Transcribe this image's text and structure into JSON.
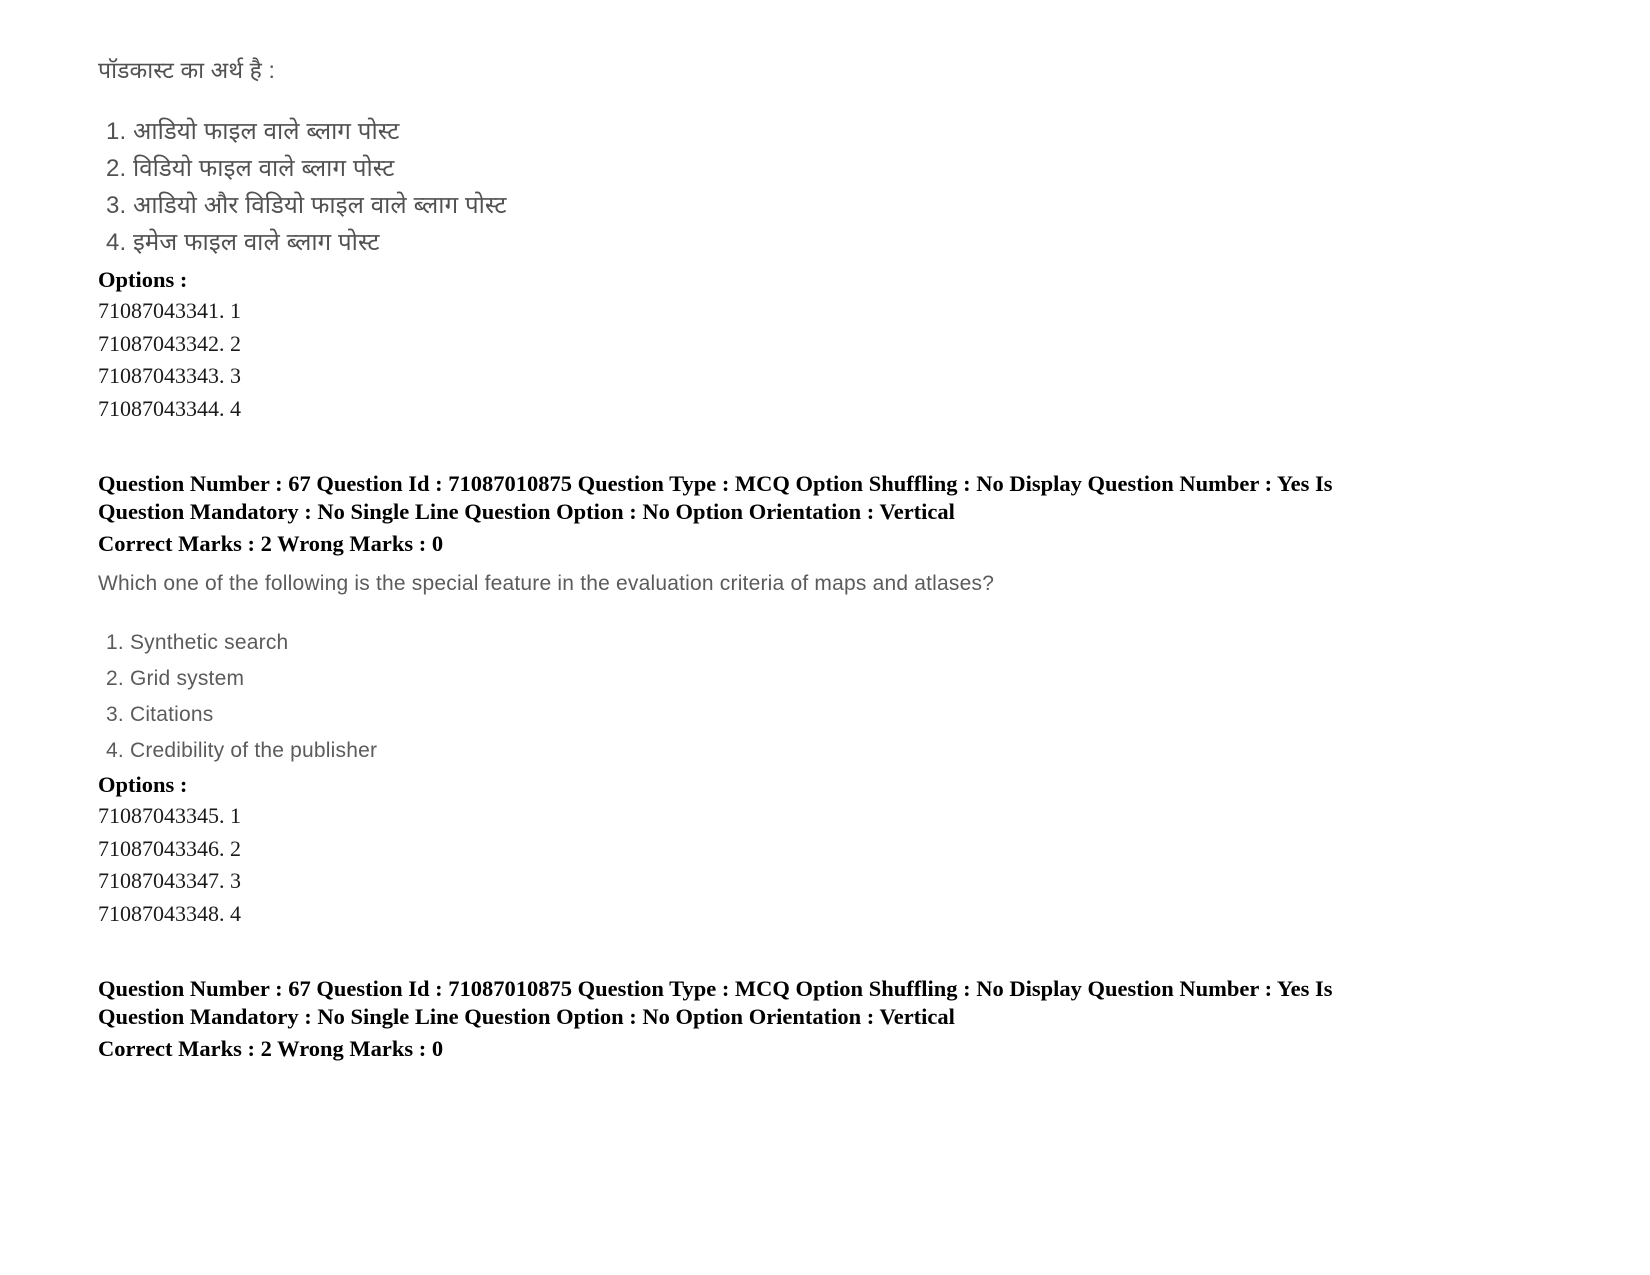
{
  "page": {
    "background": "#ffffff",
    "text_color": "#000000",
    "scan_text_color": "#3a3a3a"
  },
  "question_66": {
    "stem": "पॉडकास्ट का अर्थ है :",
    "choices": [
      "1. आडियो फाइल वाले ब्लाग पोस्ट",
      "2. विडियो  फाइल वाले ब्लाग पोस्ट",
      "3. आडियो और विडियो फाइल वाले ब्लाग पोस्ट",
      "4. इमेज फाइल वाले ब्लाग पोस्ट"
    ],
    "options_label": "Options :",
    "option_ids": [
      "71087043341. 1",
      "71087043342. 2",
      "71087043343. 3",
      "71087043344. 4"
    ]
  },
  "meta_block_1": {
    "line1": "Question Number : 67 Question Id : 71087010875 Question Type : MCQ Option Shuffling : No Display Question Number : Yes Is",
    "line2": "Question Mandatory : No Single Line Question Option : No Option Orientation : Vertical",
    "line3": "Correct Marks : 2 Wrong Marks : 0"
  },
  "question_67": {
    "stem": "Which one of the following is the special feature in the evaluation criteria of maps and atlases?",
    "choices": [
      "1. Synthetic search",
      "2. Grid system",
      "3. Citations",
      "4. Credibility of the publisher"
    ],
    "options_label": "Options :",
    "option_ids": [
      "71087043345. 1",
      "71087043346. 2",
      "71087043347. 3",
      "71087043348. 4"
    ]
  },
  "meta_block_2": {
    "line1": "Question Number : 67 Question Id : 71087010875 Question Type : MCQ Option Shuffling : No Display Question Number : Yes Is",
    "line2": "Question Mandatory : No Single Line Question Option : No Option Orientation : Vertical",
    "line3": "Correct Marks : 2 Wrong Marks : 0"
  }
}
